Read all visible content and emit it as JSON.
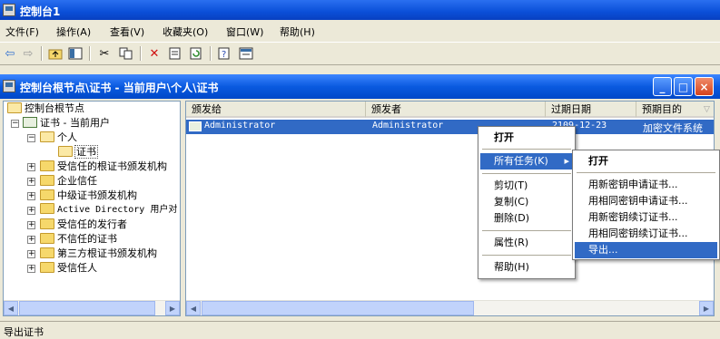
{
  "app": {
    "title": "控制台1"
  },
  "menubar": {
    "items": [
      "文件(F)",
      "操作(A)",
      "查看(V)",
      "收藏夹(O)",
      "窗口(W)",
      "帮助(H)"
    ]
  },
  "toolbar": {
    "icons": [
      "back-icon",
      "forward-icon",
      "up-folder-icon",
      "show-tree-icon",
      "cut-icon",
      "copy-icon",
      "delete-icon",
      "properties-icon",
      "refresh-icon",
      "help-icon",
      "export-list-icon"
    ]
  },
  "window": {
    "title": "控制台根节点\\证书 - 当前用户\\个人\\证书",
    "buttons": {
      "minimize": "_",
      "maximize": "□",
      "close": "×"
    }
  },
  "tree": {
    "root": "控制台根节点",
    "store": "证书 - 当前用户",
    "personal": "个人",
    "certs": "证书",
    "folders": [
      "受信任的根证书颁发机构",
      "企业信任",
      "中级证书颁发机构",
      "Active Directory 用户对",
      "受信任的发行者",
      "不信任的证书",
      "第三方根证书颁发机构",
      "受信任人"
    ]
  },
  "list": {
    "columns": [
      "颁发给",
      "颁发者",
      "过期日期",
      "预期目的"
    ],
    "rows": [
      {
        "issued_to": "Administrator",
        "issued_by": "Administrator",
        "expires": "2109-12-23",
        "purpose": "加密文件系统"
      }
    ]
  },
  "context_menu": {
    "open": "打开",
    "all_tasks": "所有任务(K)",
    "cut": "剪切(T)",
    "copy": "复制(C)",
    "delete": "删除(D)",
    "properties": "属性(R)",
    "help": "帮助(H)"
  },
  "submenu": {
    "open": "打开",
    "items": [
      "用新密钥申请证书...",
      "用相同密钥申请证书...",
      "用新密钥续订证书...",
      "用相同密钥续订证书..."
    ],
    "export": "导出..."
  },
  "status": {
    "text": "导出证书"
  }
}
